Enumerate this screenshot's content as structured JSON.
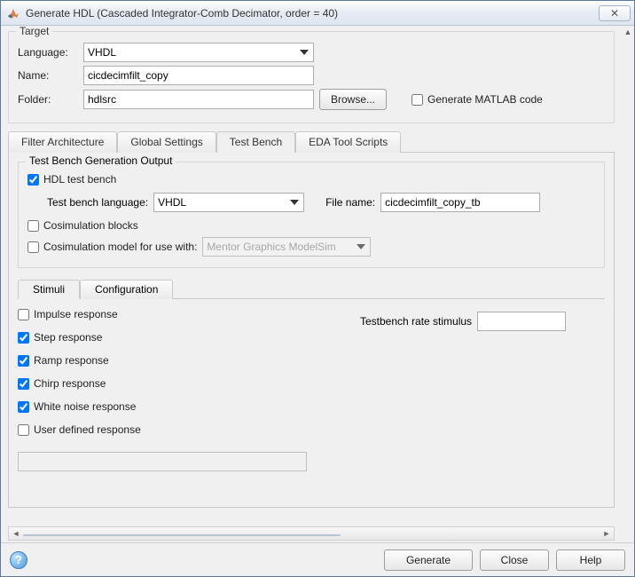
{
  "window": {
    "title": "Generate HDL (Cascaded Integrator-Comb Decimator, order = 40)",
    "close_glyph": "✕"
  },
  "target": {
    "group_title": "Target",
    "language_label": "Language:",
    "language_value": "VHDL",
    "name_label": "Name:",
    "name_value": "cicdecimfilt_copy",
    "folder_label": "Folder:",
    "folder_value": "hdlsrc",
    "browse_label": "Browse...",
    "gen_matlab_label": "Generate MATLAB code",
    "gen_matlab_checked": false
  },
  "main_tabs": {
    "items": [
      {
        "label": "Filter Architecture"
      },
      {
        "label": "Global Settings"
      },
      {
        "label": "Test Bench"
      },
      {
        "label": "EDA Tool Scripts"
      }
    ],
    "active_index": 2
  },
  "testbench": {
    "group_title": "Test Bench Generation Output",
    "hdl_tb_label": "HDL test bench",
    "hdl_tb_checked": true,
    "tb_lang_label": "Test bench language:",
    "tb_lang_value": "VHDL",
    "file_name_label": "File name:",
    "file_name_value": "cicdecimfilt_copy_tb",
    "cosim_blocks_label": "Cosimulation blocks",
    "cosim_blocks_checked": false,
    "cosim_model_label": "Cosimulation model for use with:",
    "cosim_model_checked": false,
    "cosim_tool_value": "Mentor Graphics ModelSim"
  },
  "sub_tabs": {
    "items": [
      {
        "label": "Stimuli"
      },
      {
        "label": "Configuration"
      }
    ],
    "active_index": 0
  },
  "stimuli": {
    "impulse_label": "Impulse response",
    "impulse_checked": false,
    "step_label": "Step response",
    "step_checked": true,
    "ramp_label": "Ramp response",
    "ramp_checked": true,
    "chirp_label": "Chirp response",
    "chirp_checked": true,
    "white_label": "White noise response",
    "white_checked": true,
    "user_label": "User defined response",
    "user_checked": false,
    "user_value": "",
    "rate_label": "Testbench rate stimulus",
    "rate_value": ""
  },
  "footer": {
    "generate_label": "Generate",
    "close_label": "Close",
    "help_label": "Help"
  }
}
